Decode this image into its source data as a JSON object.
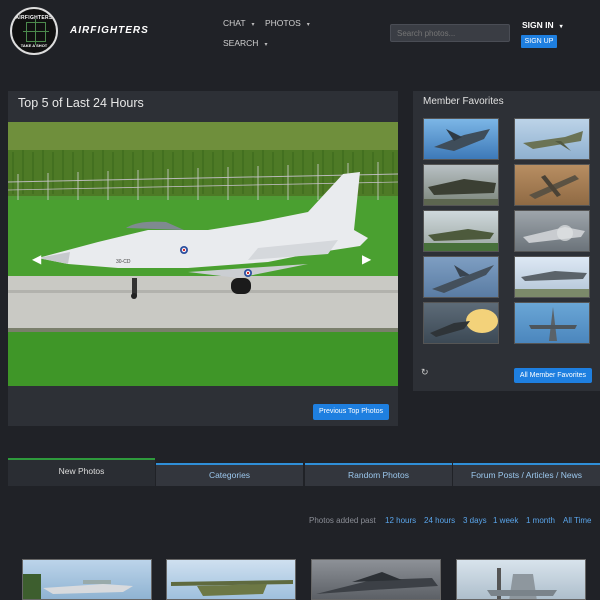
{
  "header": {
    "logo_top": "AIRFIGHTERS",
    "logo_bottom": "TAKE A SHOT",
    "brand": "AIRFIGHTERS",
    "nav": {
      "chat": "CHAT",
      "photos": "PHOTOS",
      "search": "SEARCH"
    },
    "search_placeholder": "Search photos...",
    "signin": "SIGN IN",
    "signup": "SIGN UP"
  },
  "top5": {
    "title": "Top 5 of Last 24 Hours",
    "prev_button": "Previous Top Photos",
    "hero_tail_code": "30-CD"
  },
  "favorites": {
    "title": "Member Favorites",
    "all_button": "All Member Favorites",
    "thumb_count": 10
  },
  "tabs": [
    "New Photos",
    "Categories",
    "Random Photos",
    "Forum Posts / Articles / News"
  ],
  "time_filter": {
    "label": "Photos added past",
    "options": [
      "12 hours",
      "24 hours",
      "3 days",
      "1 week",
      "1 month",
      "All Time"
    ]
  },
  "colors": {
    "accent": "#1e7fe0",
    "tab_active": "#2e9a3c",
    "background": "#202227",
    "panel": "#2d3036"
  },
  "icons": {
    "refresh": "refresh-icon",
    "prev": "chevron-left-icon",
    "next": "chevron-right-icon",
    "caret": "caret-down-icon"
  }
}
